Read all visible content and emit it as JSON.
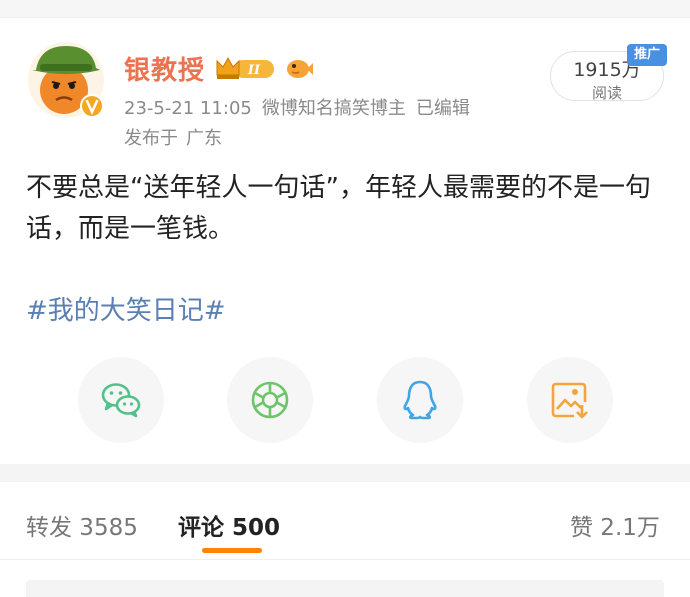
{
  "post": {
    "author": {
      "name": "银教授",
      "level_badge": "II",
      "time": "23-5-21 11:05",
      "title": "微博知名搞笑博主",
      "edited": "已编辑",
      "location_prefix": "发布于",
      "location": "广东"
    },
    "views": {
      "count": "1915万",
      "label": "阅读",
      "promo_tag": "推广"
    },
    "text": "不要总是“送年轻人一句话”，年轻人最需要的不是一句话，而是一笔钱。",
    "hashtag": "#我的大笑日记#"
  },
  "share": {
    "icons": [
      "wechat-icon",
      "moments-icon",
      "qq-icon",
      "save-image-icon"
    ]
  },
  "tabs": {
    "repost": "转发 3585",
    "comment": "评论 500",
    "like": "赞 2.1万"
  },
  "colors": {
    "username": "#eb7350",
    "hashtag": "#5a7fb3",
    "accent": "#ff8200",
    "wechat": "#4fc18a",
    "moments": "#6dc46a",
    "qq": "#3fa5e6",
    "save": "#f3a43c",
    "promo": "#4a90e2"
  }
}
